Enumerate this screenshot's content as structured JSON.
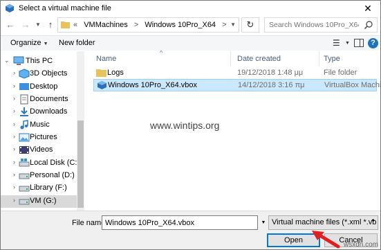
{
  "window": {
    "title": "Select a virtual machine file"
  },
  "address": {
    "parts": [
      "«",
      "VMMachines",
      ">",
      "Windows 10Pro_X64",
      ">"
    ],
    "search_placeholder": "Search Windows 10Pro_X64"
  },
  "toolbar": {
    "organize": "Organize",
    "new_folder": "New folder"
  },
  "nav": {
    "items": [
      {
        "label": "This PC"
      },
      {
        "label": "3D Objects"
      },
      {
        "label": "Desktop"
      },
      {
        "label": "Documents"
      },
      {
        "label": "Downloads"
      },
      {
        "label": "Music"
      },
      {
        "label": "Pictures"
      },
      {
        "label": "Videos"
      },
      {
        "label": "Local Disk (C:)"
      },
      {
        "label": "Personal (D:)"
      },
      {
        "label": "Library (F:)"
      },
      {
        "label": "VM (G:)"
      }
    ]
  },
  "columns": {
    "name": "Name",
    "date": "Date created",
    "type": "Type"
  },
  "files": [
    {
      "name": "Logs",
      "date": "19/12/2018 1:48 μμ",
      "type": "File folder"
    },
    {
      "name": "Windows 10Pro_X64.vbox",
      "date": "14/12/2018 3:16 πμ",
      "type": "VirtualBox Machin..."
    }
  ],
  "watermark": "www.wintips.org",
  "corner_watermark": "wsxdn.com",
  "bottom": {
    "filename_label": "File name:",
    "filename_value": "Windows 10Pro_X64.vbox",
    "filter": "Virtual machine files (*.xml *.vb",
    "open": "Open",
    "cancel": "Cancel"
  },
  "colors": {
    "accent": "#0078d7",
    "selection": "#cce8ff",
    "annotation_arrow": "#e02020"
  }
}
